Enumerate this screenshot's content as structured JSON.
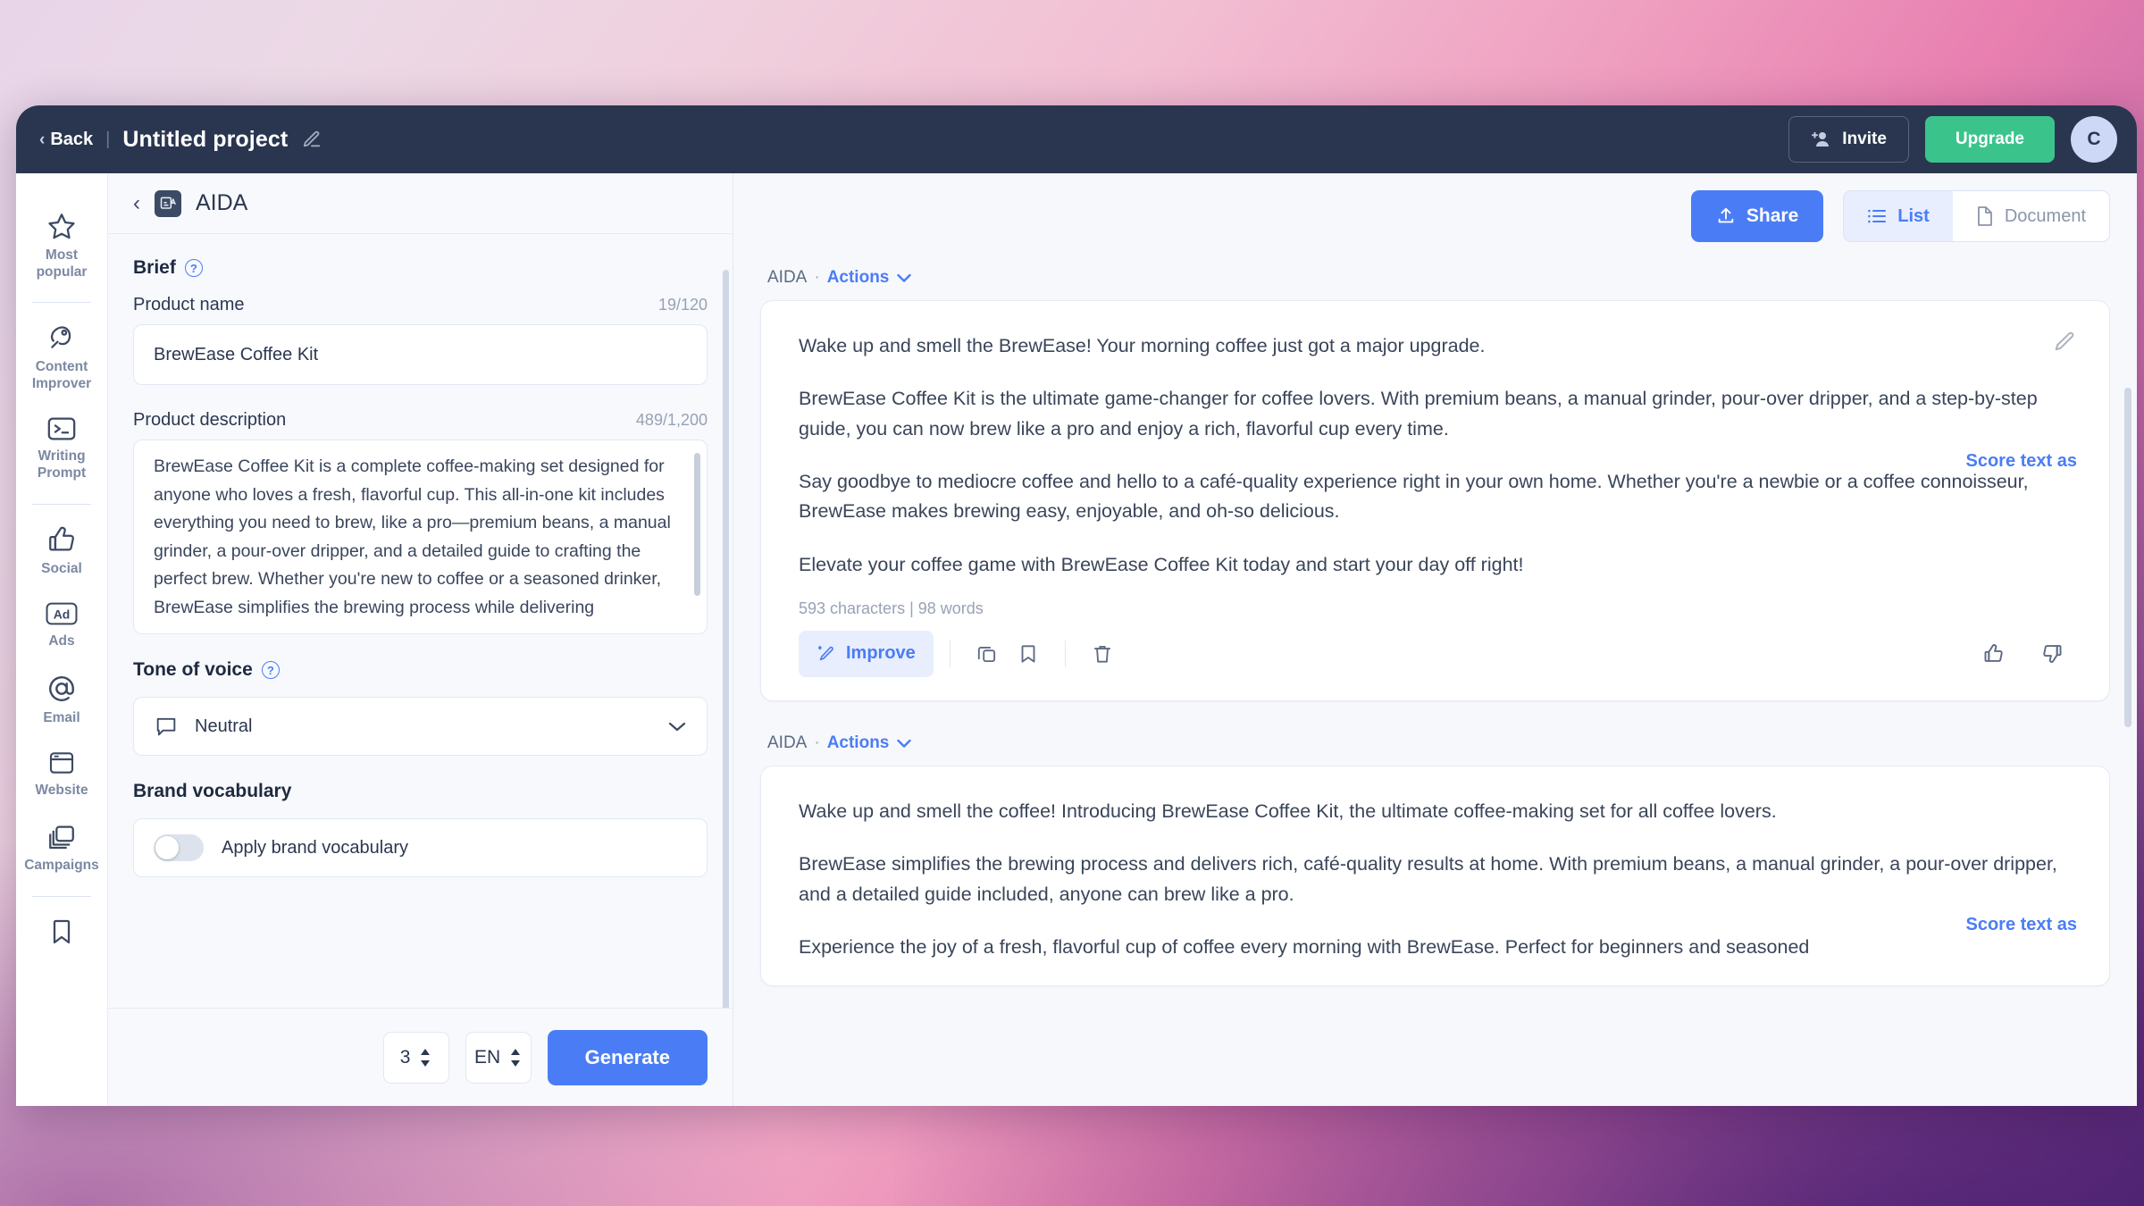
{
  "topbar": {
    "back_label": "Back",
    "project_title": "Untitled project",
    "invite_label": "Invite",
    "upgrade_label": "Upgrade",
    "avatar_initial": "C"
  },
  "rail": {
    "items": [
      {
        "label": "Most popular",
        "icon": "star-icon"
      },
      {
        "label": "Content Improver",
        "icon": "rocket-icon"
      },
      {
        "label": "Writing Prompt",
        "icon": "terminal-icon"
      },
      {
        "label": "Social",
        "icon": "thumbs-up-icon"
      },
      {
        "label": "Ads",
        "icon": "ad-icon"
      },
      {
        "label": "Email",
        "icon": "at-icon"
      },
      {
        "label": "Website",
        "icon": "browser-window-icon"
      },
      {
        "label": "Campaigns",
        "icon": "stack-icon"
      },
      {
        "label": "",
        "icon": "bookmark-icon"
      }
    ]
  },
  "left_panel": {
    "title": "AIDA",
    "brief_label": "Brief",
    "product_name_label": "Product name",
    "product_name_counter": "19/120",
    "product_name_value": "BrewEase Coffee Kit",
    "product_desc_label": "Product description",
    "product_desc_counter": "489/1,200",
    "product_desc_value": "BrewEase Coffee Kit is a complete coffee-making set designed for anyone who loves a fresh, flavorful cup. This all-in-one kit includes everything you need to brew, like a pro—premium beans, a manual grinder, a pour-over dripper, and a detailed guide to crafting the perfect brew. Whether you're new to coffee or a seasoned drinker, BrewEase simplifies the brewing process while delivering",
    "tone_label": "Tone of voice",
    "tone_value": "Neutral",
    "brand_vocab_label": "Brand vocabulary",
    "apply_brand_vocab_label": "Apply brand vocabulary",
    "apply_brand_vocab_on": false,
    "outputs_count": "3",
    "language": "EN",
    "generate_label": "Generate"
  },
  "right_panel": {
    "share_label": "Share",
    "view_list_label": "List",
    "view_document_label": "Document",
    "active_view": "List",
    "results": [
      {
        "source": "AIDA",
        "separator": "·",
        "actions_label": "Actions",
        "score_link": "Score text as",
        "paragraphs": [
          "Wake up and smell the BrewEase! Your morning coffee just got a major upgrade.",
          "BrewEase Coffee Kit is the ultimate game-changer for coffee lovers. With premium beans, a manual grinder, pour-over dripper, and a step-by-step guide, you can now brew like a pro and enjoy a rich, flavorful cup every time.",
          "Say goodbye to mediocre coffee and hello to a café-quality experience right in your own home. Whether you're a newbie or a coffee connoisseur, BrewEase makes brewing easy, enjoyable, and oh-so delicious.",
          "Elevate your coffee game with BrewEase Coffee Kit today and start your day off right!"
        ],
        "count_line": "593 characters | 98 words",
        "improve_label": "Improve"
      },
      {
        "source": "AIDA",
        "separator": "·",
        "actions_label": "Actions",
        "score_link": "Score text as",
        "paragraphs": [
          "Wake up and smell the coffee! Introducing BrewEase Coffee Kit, the ultimate coffee-making set for all coffee lovers.",
          "BrewEase simplifies the brewing process and delivers rich, café-quality results at home. With premium beans, a manual grinder, a pour-over dripper, and a detailed guide included, anyone can brew like a pro.",
          "Experience the joy of a fresh, flavorful cup of coffee every morning with BrewEase. Perfect for beginners and seasoned"
        ]
      }
    ]
  },
  "colors": {
    "accent_blue": "#4a7df5",
    "accent_green": "#3ac48c",
    "topbar_navy": "#2a3650"
  }
}
